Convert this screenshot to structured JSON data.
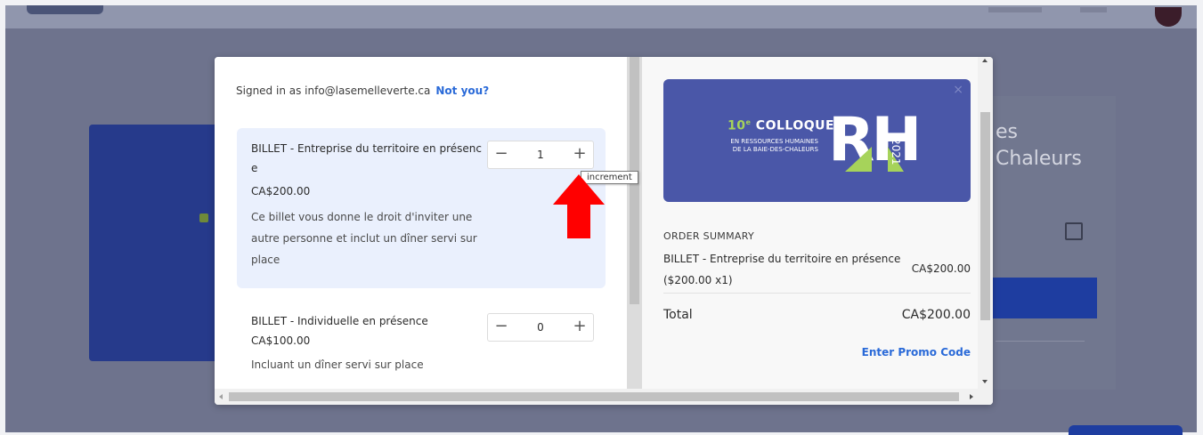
{
  "colors": {
    "accent": "#2a6ad8",
    "banner_bg": "#4a57a8",
    "banner_green": "#a6d35a",
    "selected_ticket_bg": "#eaf0fd",
    "annotation_arrow": "#ff0000",
    "overlay": "#6e738d"
  },
  "session": {
    "signed_in_text": "Signed in as info@lasemelleverte.ca",
    "not_you_label": "Not you?"
  },
  "tickets": [
    {
      "name": "BILLET - Entreprise du territoire en présence",
      "price": "CA$200.00",
      "description": "Ce billet vous donne le droit d'inviter une autre personne et inclut un dîner servi sur place",
      "quantity": "1",
      "decrement_label": "−",
      "increment_label": "+"
    },
    {
      "name": "BILLET - Individuelle en présence",
      "price": "CA$100.00",
      "description": "Incluant un dîner servi sur place",
      "quantity": "0",
      "decrement_label": "−",
      "increment_label": "+"
    }
  ],
  "tooltip": {
    "text": "increment"
  },
  "banner": {
    "edition": "10",
    "edition_suffix": "e",
    "title": "COLLOQUE",
    "subtitle_line1": "EN RESSOURCES HUMAINES",
    "subtitle_line2": "DE LA BAIE-DES-CHALEURS",
    "logo_letters": "RH",
    "year": "2021",
    "close_label": "×"
  },
  "order": {
    "title": "ORDER SUMMARY",
    "item_name": "BILLET - Entreprise du territoire en présence",
    "item_detail": "($200.00 x1)",
    "item_amount": "CA$200.00",
    "total_label": "Total",
    "total_amount": "CA$200.00",
    "promo_label": "Enter Promo Code"
  },
  "background": {
    "right_card_heading_line1": "es",
    "right_card_heading_line2": "Chaleurs"
  }
}
